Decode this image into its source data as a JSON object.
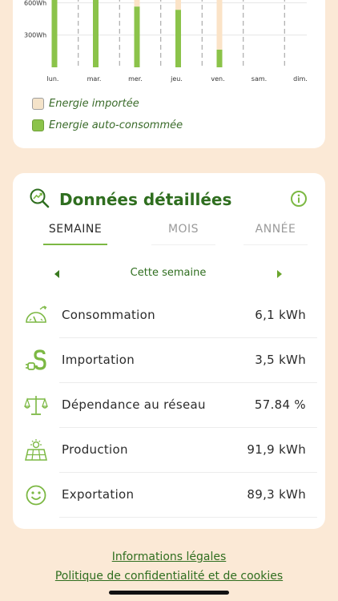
{
  "chart_data": {
    "type": "bar",
    "stacked": true,
    "categories": [
      "lun.",
      "mar.",
      "mer.",
      "jeu.",
      "ven.",
      "sam.",
      "dim."
    ],
    "yticks": [
      "600Wh",
      "300Wh"
    ],
    "ytick_values": [
      600,
      300
    ],
    "series": [
      {
        "name": "Energie auto-consommée",
        "color": "#8bc34a",
        "values": [
          730,
          730,
          565,
          535,
          165,
          0,
          0
        ]
      },
      {
        "name": "Energie importée",
        "color": "#fbe3c7",
        "values": [
          0,
          0,
          165,
          195,
          565,
          0,
          0
        ]
      }
    ],
    "ylim": [
      0,
      730
    ],
    "grid": true,
    "legend_position": "bottom-left"
  },
  "legend": {
    "imported": "Energie importée",
    "self_consumed": "Energie auto-consommée",
    "imported_color": "#f4e3c9",
    "self_consumed_color": "#8bc34a"
  },
  "details": {
    "title": "Données détaillées",
    "tabs": [
      "SEMAINE",
      "MOIS",
      "ANNÉE"
    ],
    "period_label": "Cette semaine",
    "metrics": [
      {
        "icon": "gauge-icon",
        "label": "Consommation",
        "value": "6,1 kWh"
      },
      {
        "icon": "plug-icon",
        "label": "Importation",
        "value": "3,5 kWh"
      },
      {
        "icon": "scale-icon",
        "label": "Dépendance au réseau",
        "value": "57.84 %"
      },
      {
        "icon": "solar-panel-icon",
        "label": "Production",
        "value": "91,9 kWh"
      },
      {
        "icon": "smiley-icon",
        "label": "Exportation",
        "value": "89,3 kWh"
      }
    ]
  },
  "footer": {
    "legal": "Informations légales",
    "privacy": "Politique de confidentialité et de cookies"
  },
  "colors": {
    "background": "#fbe9d6",
    "accent_green": "#2f6e1f",
    "bar_green": "#8bc34a"
  }
}
